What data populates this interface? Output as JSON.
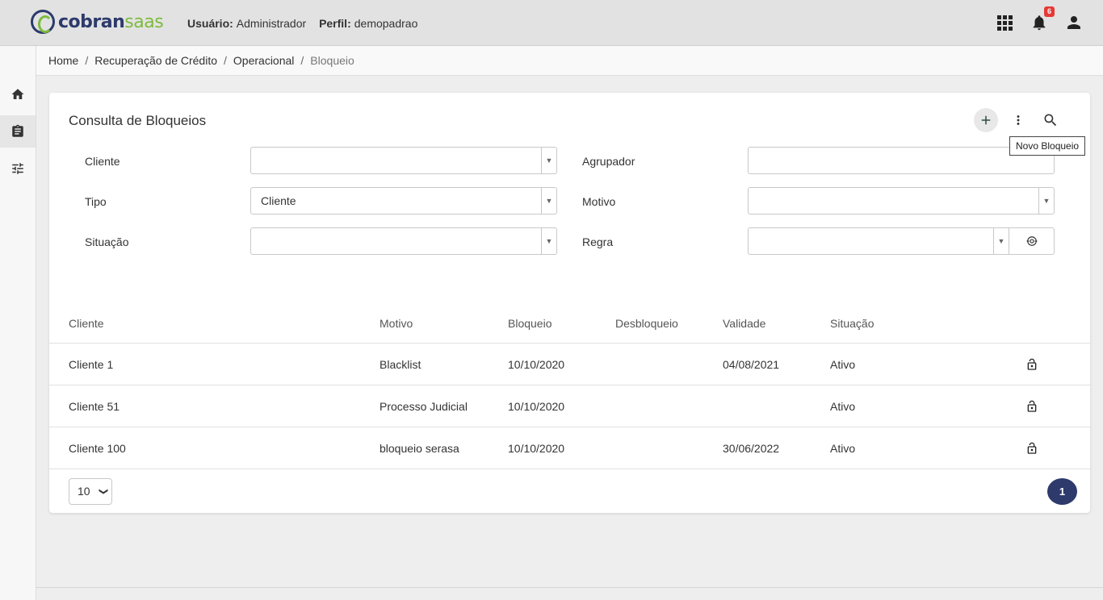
{
  "app": {
    "logo_part1": "cobran",
    "logo_part2": "saas"
  },
  "header": {
    "user_label": "Usuário:",
    "user_value": "Administrador",
    "profile_label": "Perfil:",
    "profile_value": "demopadrao",
    "notifications_count": "6"
  },
  "breadcrumb": {
    "items": [
      "Home",
      "Recuperação de Crédito",
      "Operacional"
    ],
    "current": "Bloqueio",
    "separator": "/"
  },
  "page": {
    "title": "Consulta de Bloqueios",
    "tooltip": "Novo Bloqueio"
  },
  "filters": {
    "cliente": {
      "label": "Cliente",
      "value": ""
    },
    "agrupador": {
      "label": "Agrupador",
      "value": ""
    },
    "tipo": {
      "label": "Tipo",
      "value": "Cliente"
    },
    "motivo": {
      "label": "Motivo",
      "value": ""
    },
    "situacao": {
      "label": "Situação",
      "value": ""
    },
    "regra": {
      "label": "Regra",
      "value": ""
    }
  },
  "table": {
    "columns": [
      "Cliente",
      "Motivo",
      "Bloqueio",
      "Desbloqueio",
      "Validade",
      "Situação"
    ],
    "rows": [
      {
        "cliente": "Cliente 1",
        "motivo": "Blacklist",
        "bloqueio": "10/10/2020",
        "desbloqueio": "",
        "validade": "04/08/2021",
        "situacao": "Ativo"
      },
      {
        "cliente": "Cliente 51",
        "motivo": "Processo Judicial",
        "bloqueio": "10/10/2020",
        "desbloqueio": "",
        "validade": "",
        "situacao": "Ativo"
      },
      {
        "cliente": "Cliente 100",
        "motivo": "bloqueio serasa",
        "bloqueio": "10/10/2020",
        "desbloqueio": "",
        "validade": "30/06/2022",
        "situacao": "Ativo"
      }
    ]
  },
  "pagination": {
    "page_size": "10",
    "current_page": "1"
  },
  "colors": {
    "brand_navy": "#2d3a6b",
    "brand_green": "#7dbb3c",
    "badge_red": "#e53935"
  },
  "icons": {
    "home": "home-icon",
    "clipboard": "clipboard-icon",
    "settings": "sliders-icon",
    "apps": "apps-grid-icon",
    "notifications": "bell-icon",
    "account": "person-icon",
    "add": "plus-icon",
    "more": "more-vert-icon",
    "search": "search-icon",
    "unlock": "lock-open-icon",
    "target": "target-icon"
  }
}
